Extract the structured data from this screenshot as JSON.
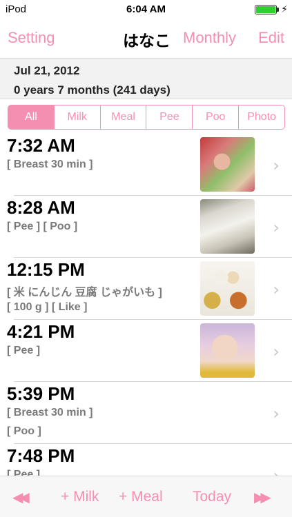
{
  "status_bar": {
    "carrier": "iPod",
    "time": "6:04 AM"
  },
  "nav": {
    "setting": "Setting",
    "title": "はなこ",
    "monthly": "Monthly",
    "edit": "Edit"
  },
  "header": {
    "date": "Jul 21, 2012",
    "age": "0 years 7 months (241 days)"
  },
  "filters": [
    "All",
    "Milk",
    "Meal",
    "Pee",
    "Poo",
    "Photo"
  ],
  "selected_filter": "All",
  "entries": [
    {
      "time": "7:32 AM",
      "line1": "[ Breast 30 min ]",
      "line2": "",
      "photo": "baby-photo"
    },
    {
      "time": "8:28 AM",
      "line1": "[ Pee ] [ Poo ]",
      "line2": "",
      "photo": "diaper-photo"
    },
    {
      "time": "12:15 PM",
      "line1": "[ 米 にんじん 豆腐 じゃがいも ]",
      "line2": "[ 100 g ] [ Like ]",
      "photo": "meal-photo"
    },
    {
      "time": "4:21 PM",
      "line1": "[ Pee ]",
      "line2": "",
      "photo": "sleeping-baby-photo"
    },
    {
      "time": "5:39 PM",
      "line1": "[ Breast 30 min ]",
      "line2": "[ Poo ]",
      "photo": ""
    },
    {
      "time": "7:48 PM",
      "line1": "[ Pee ]",
      "line2": "",
      "photo": ""
    }
  ],
  "toolbar": {
    "prev": "◀◀",
    "milk": "+ Milk",
    "meal": "+ Meal",
    "today": "Today",
    "next": "▶▶"
  },
  "colors": {
    "accent": "#f58fb1",
    "battery": "#33cc33",
    "header_bg": "#f2f2f2",
    "secondary_text": "#7a7a7a"
  }
}
